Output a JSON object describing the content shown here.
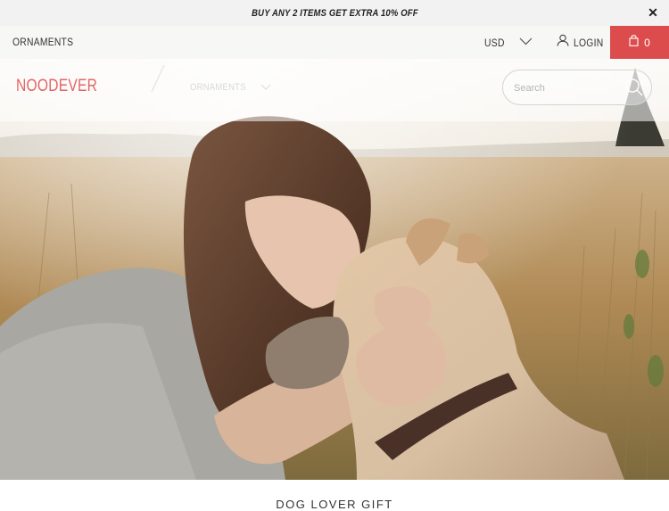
{
  "announcement": {
    "text": "BUY ANY 2 ITEMS GET EXTRA 10% OFF",
    "close_icon": "close-icon"
  },
  "topbar": {
    "left_link": "ORNAMENTS",
    "currency": "USD",
    "login": "LOGIN",
    "cart_count": "0",
    "accent_color": "#dd4c4c"
  },
  "header": {
    "logo": "NOODEVER",
    "logo_color": "#e06666",
    "nav": [
      {
        "label": "ORNAMENTS"
      }
    ],
    "search": {
      "placeholder": "Search"
    }
  },
  "hero": {
    "icon": "photo-woman-kissing-dog"
  },
  "section": {
    "heading": "DOG LOVER GIFT"
  }
}
